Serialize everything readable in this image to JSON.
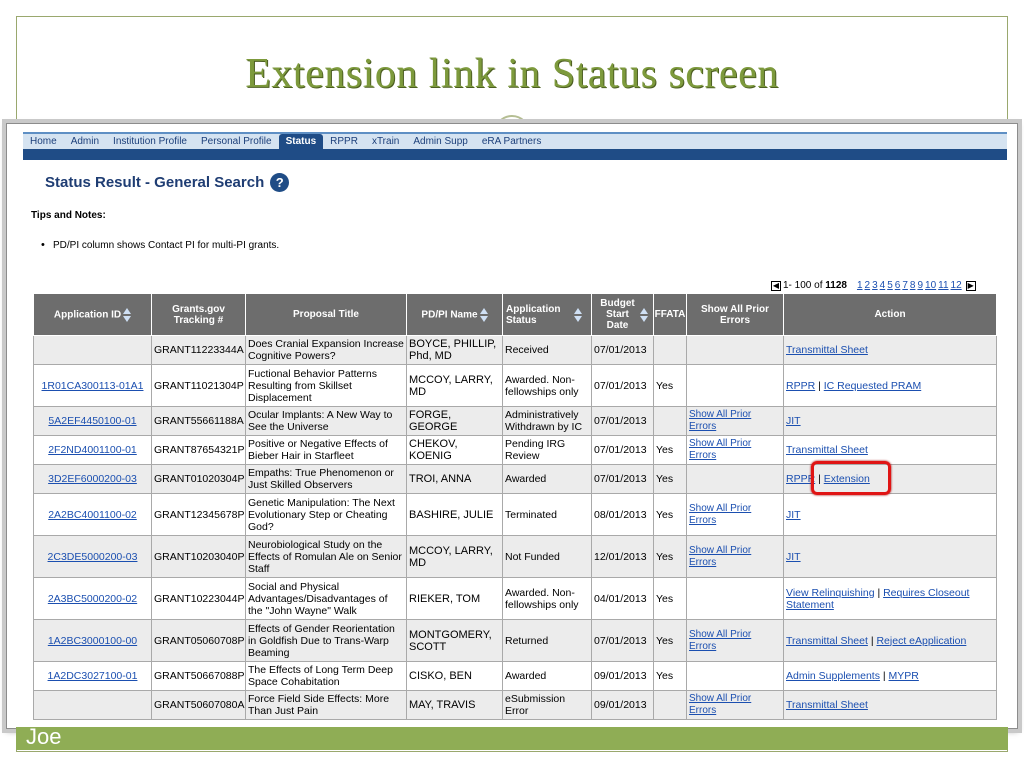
{
  "slide": {
    "title": "Extension link in Status screen",
    "footer": "Joe"
  },
  "nav": {
    "tabs": [
      {
        "label": "Home",
        "active": false
      },
      {
        "label": "Admin",
        "active": false
      },
      {
        "label": "Institution Profile",
        "active": false
      },
      {
        "label": "Personal Profile",
        "active": false
      },
      {
        "label": "Status",
        "active": true
      },
      {
        "label": "RPPR",
        "active": false
      },
      {
        "label": "xTrain",
        "active": false
      },
      {
        "label": "Admin Supp",
        "active": false
      },
      {
        "label": "eRA Partners",
        "active": false
      }
    ]
  },
  "page": {
    "title": "Status Result - General Search",
    "help_icon": "?",
    "tips_heading": "Tips and Notes:",
    "tips": [
      "PD/PI column shows Contact PI for multi-PI grants."
    ]
  },
  "pager": {
    "range": "1- 100 of",
    "total": "1128",
    "pages": [
      "1",
      "2",
      "3",
      "4",
      "5",
      "6",
      "7",
      "8",
      "9",
      "10",
      "11",
      "12"
    ]
  },
  "table": {
    "headers": {
      "app_id": "Application ID",
      "tracking": "Grants.gov Tracking #",
      "title": "Proposal Title",
      "pi": "PD/PI Name",
      "status": "Application Status",
      "budget": "Budget Start Date",
      "ffata": "FFATA",
      "errors": "Show All Prior Errors",
      "action": "Action"
    },
    "rows": [
      {
        "app_id": "",
        "tracking": "GRANT11223344A",
        "title": "Does Cranial Expansion Increase Cognitive Powers?",
        "pi": "BOYCE, PHILLIP, Phd, MD",
        "status": "Received",
        "budget": "07/01/2013",
        "ffata": "",
        "errors": "",
        "actions": [
          "Transmittal Sheet"
        ]
      },
      {
        "app_id": "1R01CA300113-01A1",
        "tracking": "GRANT11021304P",
        "title": "Fuctional Behavior Patterns Resulting from Skillset Displacement",
        "pi": "MCCOY, LARRY, MD",
        "status": "Awarded. Non-fellowships only",
        "budget": "07/01/2013",
        "ffata": "Yes",
        "errors": "",
        "actions": [
          "RPPR",
          "IC Requested PRAM"
        ]
      },
      {
        "app_id": "5A2EF4450100-01",
        "tracking": "GRANT55661188A",
        "title": "Ocular Implants: A New Way to See the Universe",
        "pi": "FORGE, GEORGE",
        "status": "Administratively Withdrawn by IC",
        "budget": "07/01/2013",
        "ffata": "",
        "errors": "Show All Prior Errors",
        "actions": [
          "JIT"
        ]
      },
      {
        "app_id": "2F2ND4001100-01",
        "tracking": "GRANT87654321P",
        "title": "Positive or Negative Effects of Bieber Hair in Starfleet",
        "pi": "CHEKOV, KOENIG",
        "status": "Pending IRG Review",
        "budget": "07/01/2013",
        "ffata": "Yes",
        "errors": "Show All Prior Errors",
        "actions": [
          "Transmittal Sheet"
        ]
      },
      {
        "app_id": "3D2EF6000200-03",
        "tracking": "GRANT01020304P",
        "title": "Empaths: True Phenomenon or Just Skilled Observers",
        "pi": "TROI, ANNA",
        "status": "Awarded",
        "budget": "07/01/2013",
        "ffata": "Yes",
        "errors": "",
        "actions": [
          "RPPR",
          "Extension"
        ]
      },
      {
        "app_id": "2A2BC4001100-02",
        "tracking": "GRANT12345678P",
        "title": "Genetic Manipulation: The Next Evolutionary Step or Cheating God?",
        "pi": "BASHIRE, JULIE",
        "status": "Terminated",
        "budget": "08/01/2013",
        "ffata": "Yes",
        "errors": "Show All Prior Errors",
        "actions": [
          "JIT"
        ]
      },
      {
        "app_id": "2C3DE5000200-03",
        "tracking": "GRANT10203040P",
        "title": "Neurobiological Study on the Effects of Romulan Ale on Senior Staff",
        "pi": "MCCOY, LARRY, MD",
        "status": "Not Funded",
        "budget": "12/01/2013",
        "ffata": "Yes",
        "errors": "Show All Prior Errors",
        "actions": [
          "JIT"
        ]
      },
      {
        "app_id": "2A3BC5000200-02",
        "tracking": "GRANT10223044P",
        "title": "Social and Physical Advantages/Disadvantages of the \"John Wayne\" Walk",
        "pi": "RIEKER, TOM",
        "status": "Awarded. Non-fellowships only",
        "budget": "04/01/2013",
        "ffata": "Yes",
        "errors": "",
        "actions": [
          "View Relinquishing",
          "Requires Closeout Statement"
        ]
      },
      {
        "app_id": "1A2BC3000100-00",
        "tracking": "GRANT05060708P",
        "title": "Effects of Gender Reorientation in Goldfish Due to Trans-Warp Beaming",
        "pi": "MONTGOMERY, SCOTT",
        "status": "Returned",
        "budget": "07/01/2013",
        "ffata": "Yes",
        "errors": "Show All Prior Errors",
        "actions": [
          "Transmittal Sheet",
          "Reject eApplication"
        ]
      },
      {
        "app_id": "1A2DC3027100-01",
        "tracking": "GRANT50667088P",
        "title": "The Effects of Long Term Deep Space Cohabitation",
        "pi": "CISKO, BEN",
        "status": "Awarded",
        "budget": "09/01/2013",
        "ffata": "Yes",
        "errors": "",
        "actions": [
          "Admin Supplements",
          "MYPR"
        ]
      },
      {
        "app_id": "",
        "tracking": "GRANT50607080A",
        "title": "Force Field Side Effects: More Than Just Pain",
        "pi": "MAY, TRAVIS",
        "status": "eSubmission Error",
        "budget": "09/01/2013",
        "ffata": "",
        "errors": "Show All Prior Errors",
        "actions": [
          "Transmittal Sheet"
        ]
      }
    ]
  }
}
